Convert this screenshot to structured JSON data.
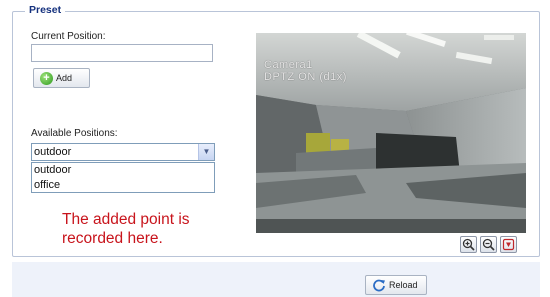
{
  "preset": {
    "legend": "Preset",
    "current_position_label": "Current Position:",
    "current_position_value": "",
    "add_button": "Add",
    "available_positions_label": "Available Positions:",
    "selected_position": "outdoor",
    "options": [
      "outdoor",
      "office"
    ]
  },
  "annotation": {
    "line1": "The added point is",
    "line2": "recorded here."
  },
  "camera": {
    "name": "Camera1",
    "status": "DPTZ ON (d1x)"
  },
  "controls": {
    "zoom_in": "zoom-in-icon",
    "zoom_out": "zoom-out-icon",
    "reset": "reset-icon"
  },
  "footer": {
    "reload_button": "Reload"
  },
  "colors": {
    "legend": "#15317e",
    "annotation": "#c8141c",
    "frame_border": "#b9c4d8"
  }
}
